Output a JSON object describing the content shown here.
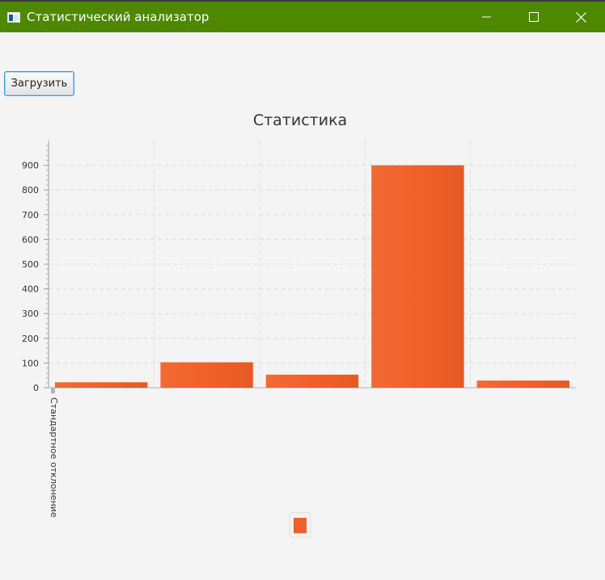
{
  "window": {
    "title": "Статистический анализатор",
    "title_bar_color": "#4e8800",
    "icons": {
      "app": "app-window-icon",
      "minimize": "minimize-icon",
      "maximize": "maximize-icon",
      "close": "close-icon"
    }
  },
  "toolbar": {
    "load_label": "Загрузить"
  },
  "chart_data": {
    "type": "bar",
    "title": "Статистика",
    "xlabel": "",
    "ylabel": "",
    "ylim": [
      0,
      1000
    ],
    "yticks": [
      0,
      100,
      200,
      300,
      400,
      500,
      600,
      700,
      800,
      900
    ],
    "grid": true,
    "categories": [
      "Стандартное отклонение"
    ],
    "series": [
      {
        "values": [
          22,
          103,
          53,
          900,
          29
        ]
      }
    ],
    "bar_color": "#f0602a",
    "legend": {
      "position": "bottom",
      "entries": [
        ""
      ]
    }
  }
}
